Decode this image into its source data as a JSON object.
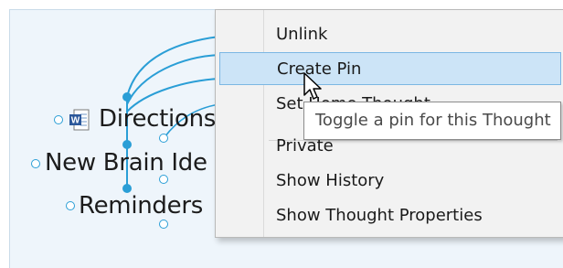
{
  "brain": {
    "thoughts": [
      {
        "name": "Directions"
      },
      {
        "name": "New Brain Ide"
      },
      {
        "name": "Reminders"
      }
    ],
    "attachment_icon": "word-document-icon",
    "link_color": "#2a9ed6"
  },
  "context_menu": {
    "items": {
      "unlink": "Unlink",
      "create_pin": "Create Pin",
      "set_home": "Set Home Thought",
      "private": "Private",
      "show_history": "Show History",
      "show_properties": "Show Thought Properties"
    },
    "highlighted_item": "Create Pin",
    "highlight_color": "#cce4f7"
  },
  "tooltip": {
    "text": "Toggle a pin for this Thought"
  }
}
